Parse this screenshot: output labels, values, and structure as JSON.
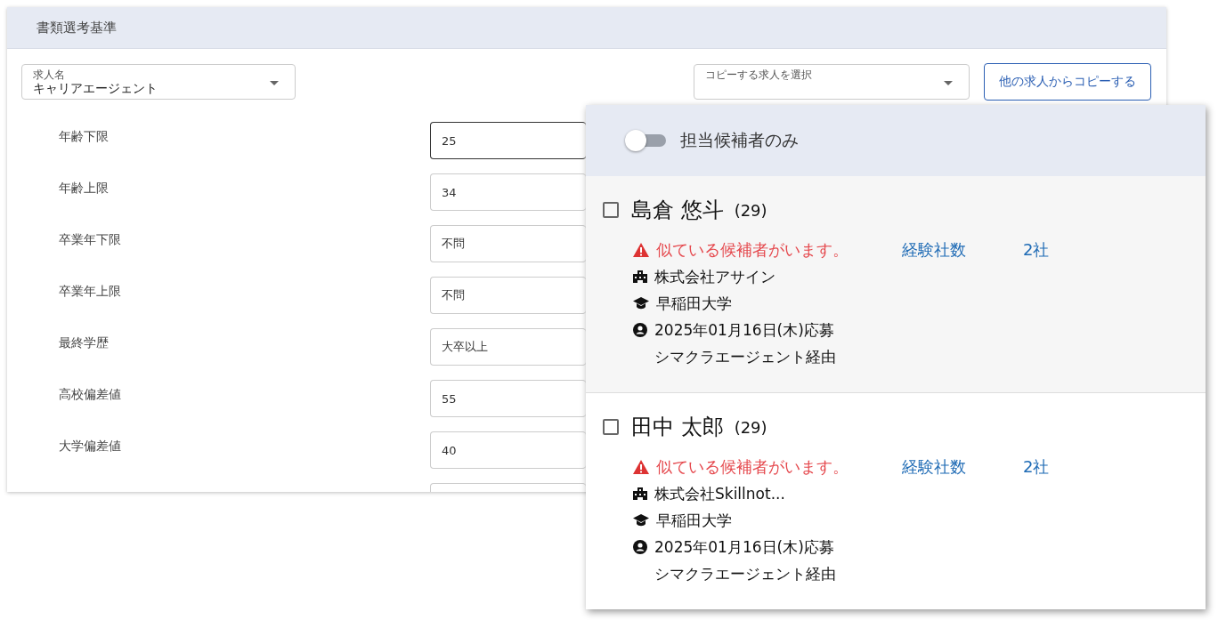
{
  "panel": {
    "title": "書類選考基準",
    "job_select": {
      "label": "求人名",
      "value": "キャリアエージェント"
    },
    "copy_select": {
      "placeholder": "コピーする求人を選択"
    },
    "copy_button": "他の求人からコピーする",
    "criteria": [
      {
        "label": "年齢下限",
        "value": "25",
        "focused": true
      },
      {
        "label": "年齢上限",
        "value": "34",
        "focused": false
      },
      {
        "label": "卒業年下限",
        "value": "不問",
        "focused": false
      },
      {
        "label": "卒業年上限",
        "value": "不問",
        "focused": false
      },
      {
        "label": "最終学歴",
        "value": "大卒以上",
        "focused": false
      },
      {
        "label": "高校偏差値",
        "value": "55",
        "focused": false
      },
      {
        "label": "大学偏差値",
        "value": "40",
        "focused": false
      }
    ]
  },
  "candidate_list": {
    "toggle": {
      "label": "担当候補者のみ",
      "on": false
    },
    "candidates": [
      {
        "name": "島倉 悠斗",
        "age": "(29)",
        "checked": false,
        "warning": "似ている候補者がいます。",
        "experience_label": "経験社数",
        "experience_value": "2社",
        "company": "株式会社アサイン",
        "school": "早稲田大学",
        "applied": "2025年01月16日(木)応募",
        "route": "シマクラエージェント経由"
      },
      {
        "name": "田中 太郎",
        "age": "(29)",
        "checked": false,
        "warning": "似ている候補者がいます。",
        "experience_label": "経験社数",
        "experience_value": "2社",
        "company": "株式会社Skillnot...",
        "school": "早稲田大学",
        "applied": "2025年01月16日(木)応募",
        "route": "シマクラエージェント経由"
      }
    ]
  }
}
